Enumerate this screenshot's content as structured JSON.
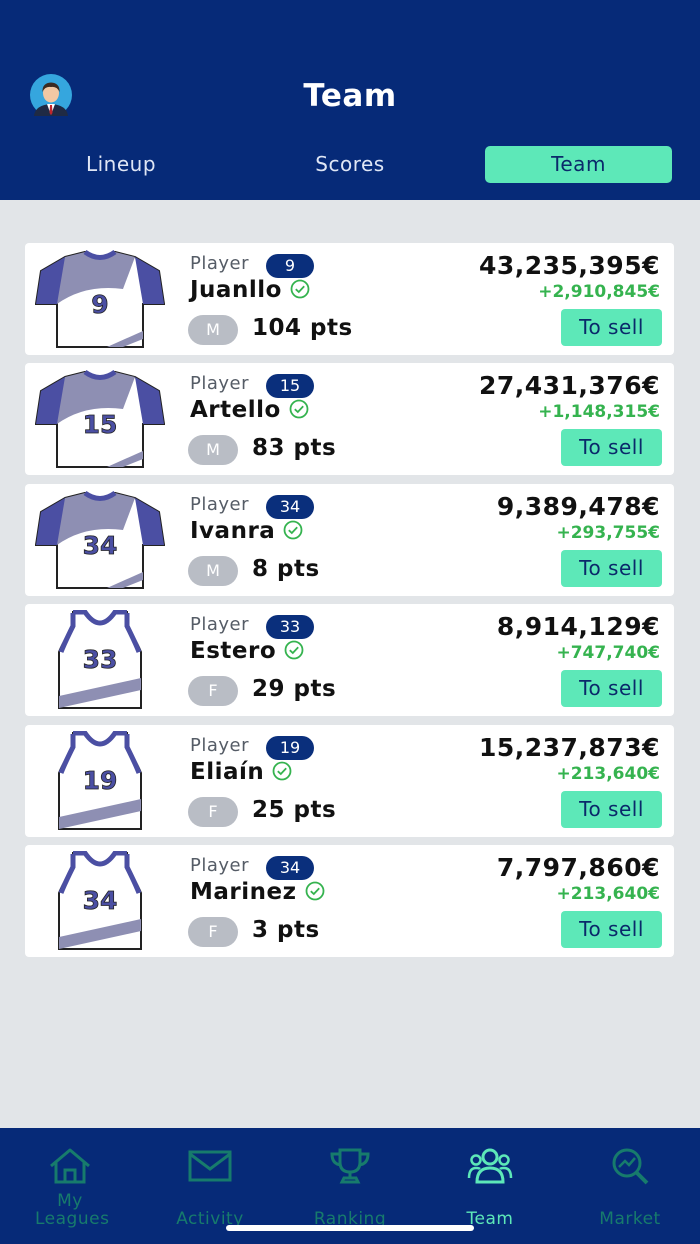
{
  "header": {
    "title": "Team",
    "tabs": [
      "Lineup",
      "Scores",
      "Team"
    ],
    "active_tab": "Team"
  },
  "players": [
    {
      "role": "Player",
      "number": "9",
      "name": "Juanllo",
      "position": "M",
      "points": "104 pts",
      "price": "43,235,395€",
      "change": "+2,910,845€",
      "action": "To sell",
      "kit": "shirt"
    },
    {
      "role": "Player",
      "number": "15",
      "name": "Artello",
      "position": "M",
      "points": "83 pts",
      "price": "27,431,376€",
      "change": "+1,148,315€",
      "action": "To sell",
      "kit": "shirt"
    },
    {
      "role": "Player",
      "number": "34",
      "name": "Ivanra",
      "position": "M",
      "points": "8 pts",
      "price": "9,389,478€",
      "change": "+293,755€",
      "action": "To sell",
      "kit": "shirt"
    },
    {
      "role": "Player",
      "number": "33",
      "name": "Estero",
      "position": "F",
      "points": "29 pts",
      "price": "8,914,129€",
      "change": "+747,740€",
      "action": "To sell",
      "kit": "tank"
    },
    {
      "role": "Player",
      "number": "19",
      "name": "Eliaín",
      "position": "F",
      "points": "25 pts",
      "price": "15,237,873€",
      "change": "+213,640€",
      "action": "To sell",
      "kit": "tank"
    },
    {
      "role": "Player",
      "number": "34",
      "name": "Marinez",
      "position": "F",
      "points": "3 pts",
      "price": "7,797,860€",
      "change": "+213,640€",
      "action": "To sell",
      "kit": "tank"
    }
  ],
  "bottom_nav": [
    {
      "label": "My Leagues",
      "icon": "home-icon"
    },
    {
      "label": "Activity",
      "icon": "mail-icon"
    },
    {
      "label": "Ranking",
      "icon": "trophy-icon"
    },
    {
      "label": "Team",
      "icon": "team-icon"
    },
    {
      "label": "Market",
      "icon": "market-search-icon"
    }
  ],
  "active_nav": "Team",
  "colors": {
    "header_bg": "#062a78",
    "accent": "#5de8b8",
    "gain": "#35b34f",
    "badge": "#0a2f7c",
    "nav_inactive": "#177b6c"
  }
}
